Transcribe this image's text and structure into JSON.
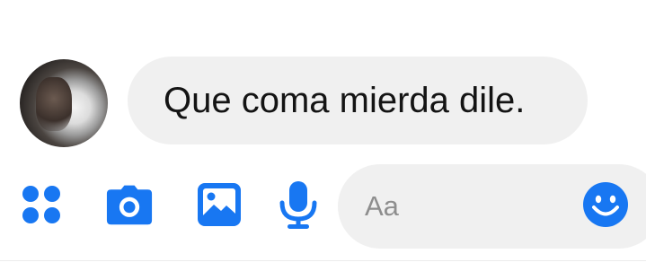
{
  "message": {
    "text": "Que coma mierda dile."
  },
  "composer": {
    "placeholder": "Aa",
    "tools": [
      "apps-icon",
      "camera-icon",
      "image-icon",
      "microphone-icon"
    ],
    "emoji": "smiley-icon"
  },
  "colors": {
    "accent": "#1877f2",
    "bubble": "#f0f0f0",
    "text": "#141414",
    "placeholder": "#8e8e8e"
  }
}
